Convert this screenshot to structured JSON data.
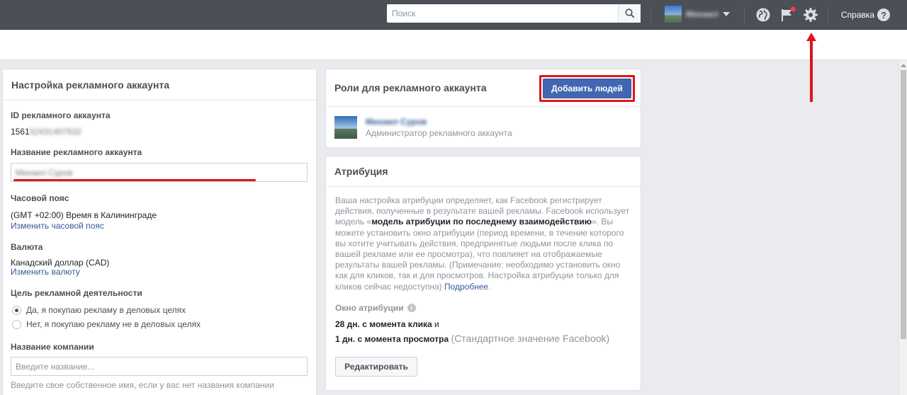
{
  "topbar": {
    "search_placeholder": "Поиск",
    "profile_name": "Михаил",
    "help_label": "Справка"
  },
  "account_settings": {
    "title": "Настройка рекламного аккаунта",
    "id_label": "ID рекламного аккаунта",
    "id_visible": "1561",
    "id_blurred": "52431407632",
    "name_label": "Название рекламного аккаунта",
    "name_value": "Михаил Суров",
    "timezone_label": "Часовой пояс",
    "timezone_value": "(GMT +02:00) Время в Калининграде",
    "timezone_link": "Изменить часовой пояс",
    "currency_label": "Валюта",
    "currency_value": "Канадский доллар (CAD)",
    "currency_link": "Изменить валюту",
    "purpose_label": "Цель рекламной деятельности",
    "purpose_options": [
      {
        "label": "Да, я покупаю рекламу в деловых целях",
        "selected": true
      },
      {
        "label": "Нет, я покупаю рекламу не в деловых целях",
        "selected": false
      }
    ],
    "company_label": "Название компании",
    "company_placeholder": "Введите название...",
    "company_hint": "Введите свое собственное имя, если у вас нет названия компании"
  },
  "roles": {
    "title": "Роли для рекламного аккаунта",
    "add_button": "Добавить людей",
    "person_name": "Михаил Суров",
    "person_role": "Администратор рекламного аккаунта"
  },
  "attribution": {
    "title": "Атрибуция",
    "text_1": "Ваша настройка атрибуции определяет, как Facebook регистрирует действия, полученные в результате вашей рекламы. Facebook использует модель «",
    "text_bold": "модель атрибуции по последнему взаимодействию",
    "text_2": "». Вы можете установить окно атрибуции (период времени, в течение которого вы хотите учитывать действия, предпринятые людьми после клика по вашей рекламе или ее просмотра), что повлияет на отображаемые результаты вашей рекламы. (Примечание: необходимо установить окно как для кликов, так и для просмотров. Настройка атрибуции только для кликов сейчас недоступна) ",
    "more_link": "Подробнее",
    "text_end": ".",
    "window_label": "Окно атрибуции",
    "click_window": "28 дн. с момента клика",
    "and_word": " и",
    "view_window": "1 дн. с момента просмотра",
    "default_note": "(Стандартное значение Facebook)",
    "edit_button": "Редактировать"
  },
  "colors": {
    "topbar": "#4b4f56",
    "primary_button": "#4267b2",
    "link": "#365899",
    "annotation_red": "#e0141e"
  }
}
